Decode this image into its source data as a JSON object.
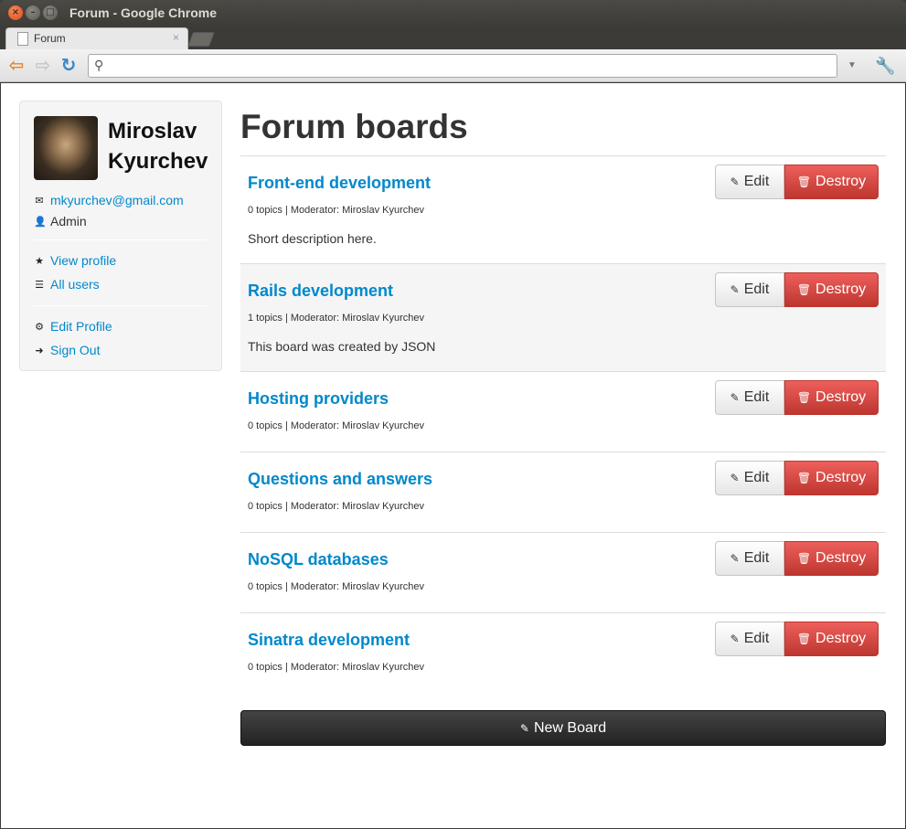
{
  "window": {
    "title": "Forum - Google Chrome"
  },
  "browser": {
    "tab_title": "Forum",
    "tab_close": "×",
    "address": "",
    "icons": [
      "back-arrow-icon",
      "forward-arrow-icon",
      "reload-icon",
      "search-icon",
      "dropdown-icon",
      "wrench-icon"
    ]
  },
  "profile": {
    "name": "Miroslav Kyurchev",
    "email": "mkyurchev@gmail.com",
    "role": "Admin",
    "links": {
      "view_profile": "View profile",
      "all_users": "All users",
      "edit_profile": "Edit Profile",
      "sign_out": "Sign Out"
    }
  },
  "main": {
    "title": "Forum boards",
    "edit_label": "Edit",
    "destroy_label": "Destroy",
    "new_board_label": "New Board"
  },
  "boards": [
    {
      "title": "Front-end development",
      "meta": "0 topics | Moderator: Miroslav Kyurchev",
      "description": "Short description here."
    },
    {
      "title": "Rails development",
      "meta": "1 topics | Moderator: Miroslav Kyurchev",
      "description": "This board was created by JSON"
    },
    {
      "title": "Hosting providers",
      "meta": "0 topics | Moderator: Miroslav Kyurchev",
      "description": ""
    },
    {
      "title": "Questions and answers",
      "meta": "0 topics | Moderator: Miroslav Kyurchev",
      "description": ""
    },
    {
      "title": "NoSQL databases",
      "meta": "0 topics | Moderator: Miroslav Kyurchev",
      "description": ""
    },
    {
      "title": "Sinatra development",
      "meta": "0 topics | Moderator: Miroslav Kyurchev",
      "description": ""
    }
  ],
  "colors": {
    "link": "#0088cc",
    "danger": "#da4f49",
    "dark_button": "#333333",
    "alt_row": "#f5f5f5"
  }
}
